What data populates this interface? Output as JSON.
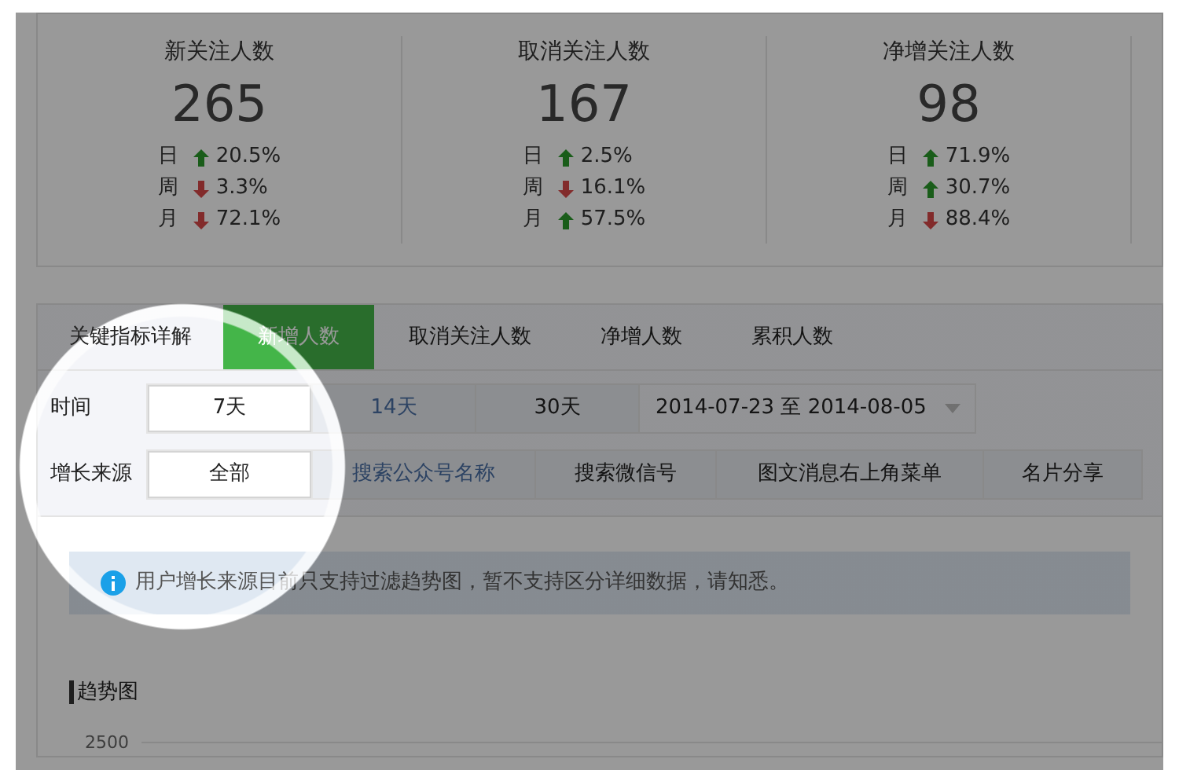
{
  "stats": [
    {
      "title": "新关注人数",
      "value": "265",
      "changes": [
        {
          "period": "日",
          "up": true,
          "change": "20.5%"
        },
        {
          "period": "周",
          "up": false,
          "change": "3.3%"
        },
        {
          "period": "月",
          "up": false,
          "change": "72.1%"
        }
      ]
    },
    {
      "title": "取消关注人数",
      "value": "167",
      "changes": [
        {
          "period": "日",
          "up": true,
          "change": "2.5%"
        },
        {
          "period": "周",
          "up": false,
          "change": "16.1%"
        },
        {
          "period": "月",
          "up": true,
          "change": "57.5%"
        }
      ]
    },
    {
      "title": "净增关注人数",
      "value": "98",
      "changes": [
        {
          "period": "日",
          "up": true,
          "change": "71.9%"
        },
        {
          "period": "周",
          "up": true,
          "change": "30.7%"
        },
        {
          "period": "月",
          "up": false,
          "change": "88.4%"
        }
      ]
    }
  ],
  "detail_title": "关键指标详解",
  "tabs": [
    {
      "label": "新增人数",
      "selected": true
    },
    {
      "label": "取消关注人数",
      "selected": false
    },
    {
      "label": "净增人数",
      "selected": false
    },
    {
      "label": "累积人数",
      "selected": false
    }
  ],
  "time_filter": {
    "label": "时间",
    "options": [
      {
        "label": "7天",
        "selected": true,
        "highlighted": false
      },
      {
        "label": "14天",
        "selected": false,
        "highlighted": true
      },
      {
        "label": "30天",
        "selected": false,
        "highlighted": false
      }
    ],
    "date_range": "2014-07-23 至 2014-08-05"
  },
  "source_filter": {
    "label": "增长来源",
    "options": [
      {
        "label": "全部",
        "selected": true,
        "highlighted": false
      },
      {
        "label": "搜索公众号名称",
        "selected": false,
        "highlighted": true
      },
      {
        "label": "搜索微信号",
        "selected": false,
        "highlighted": false
      },
      {
        "label": "图文消息右上角菜单",
        "selected": false,
        "highlighted": false
      },
      {
        "label": "名片分享",
        "selected": false,
        "highlighted": false
      }
    ]
  },
  "notice": "用户增长来源目前只支持过滤趋势图，暂不支持区分详细数据，请知悉。",
  "trend": {
    "title": "趋势图",
    "y_tick": "2500"
  }
}
